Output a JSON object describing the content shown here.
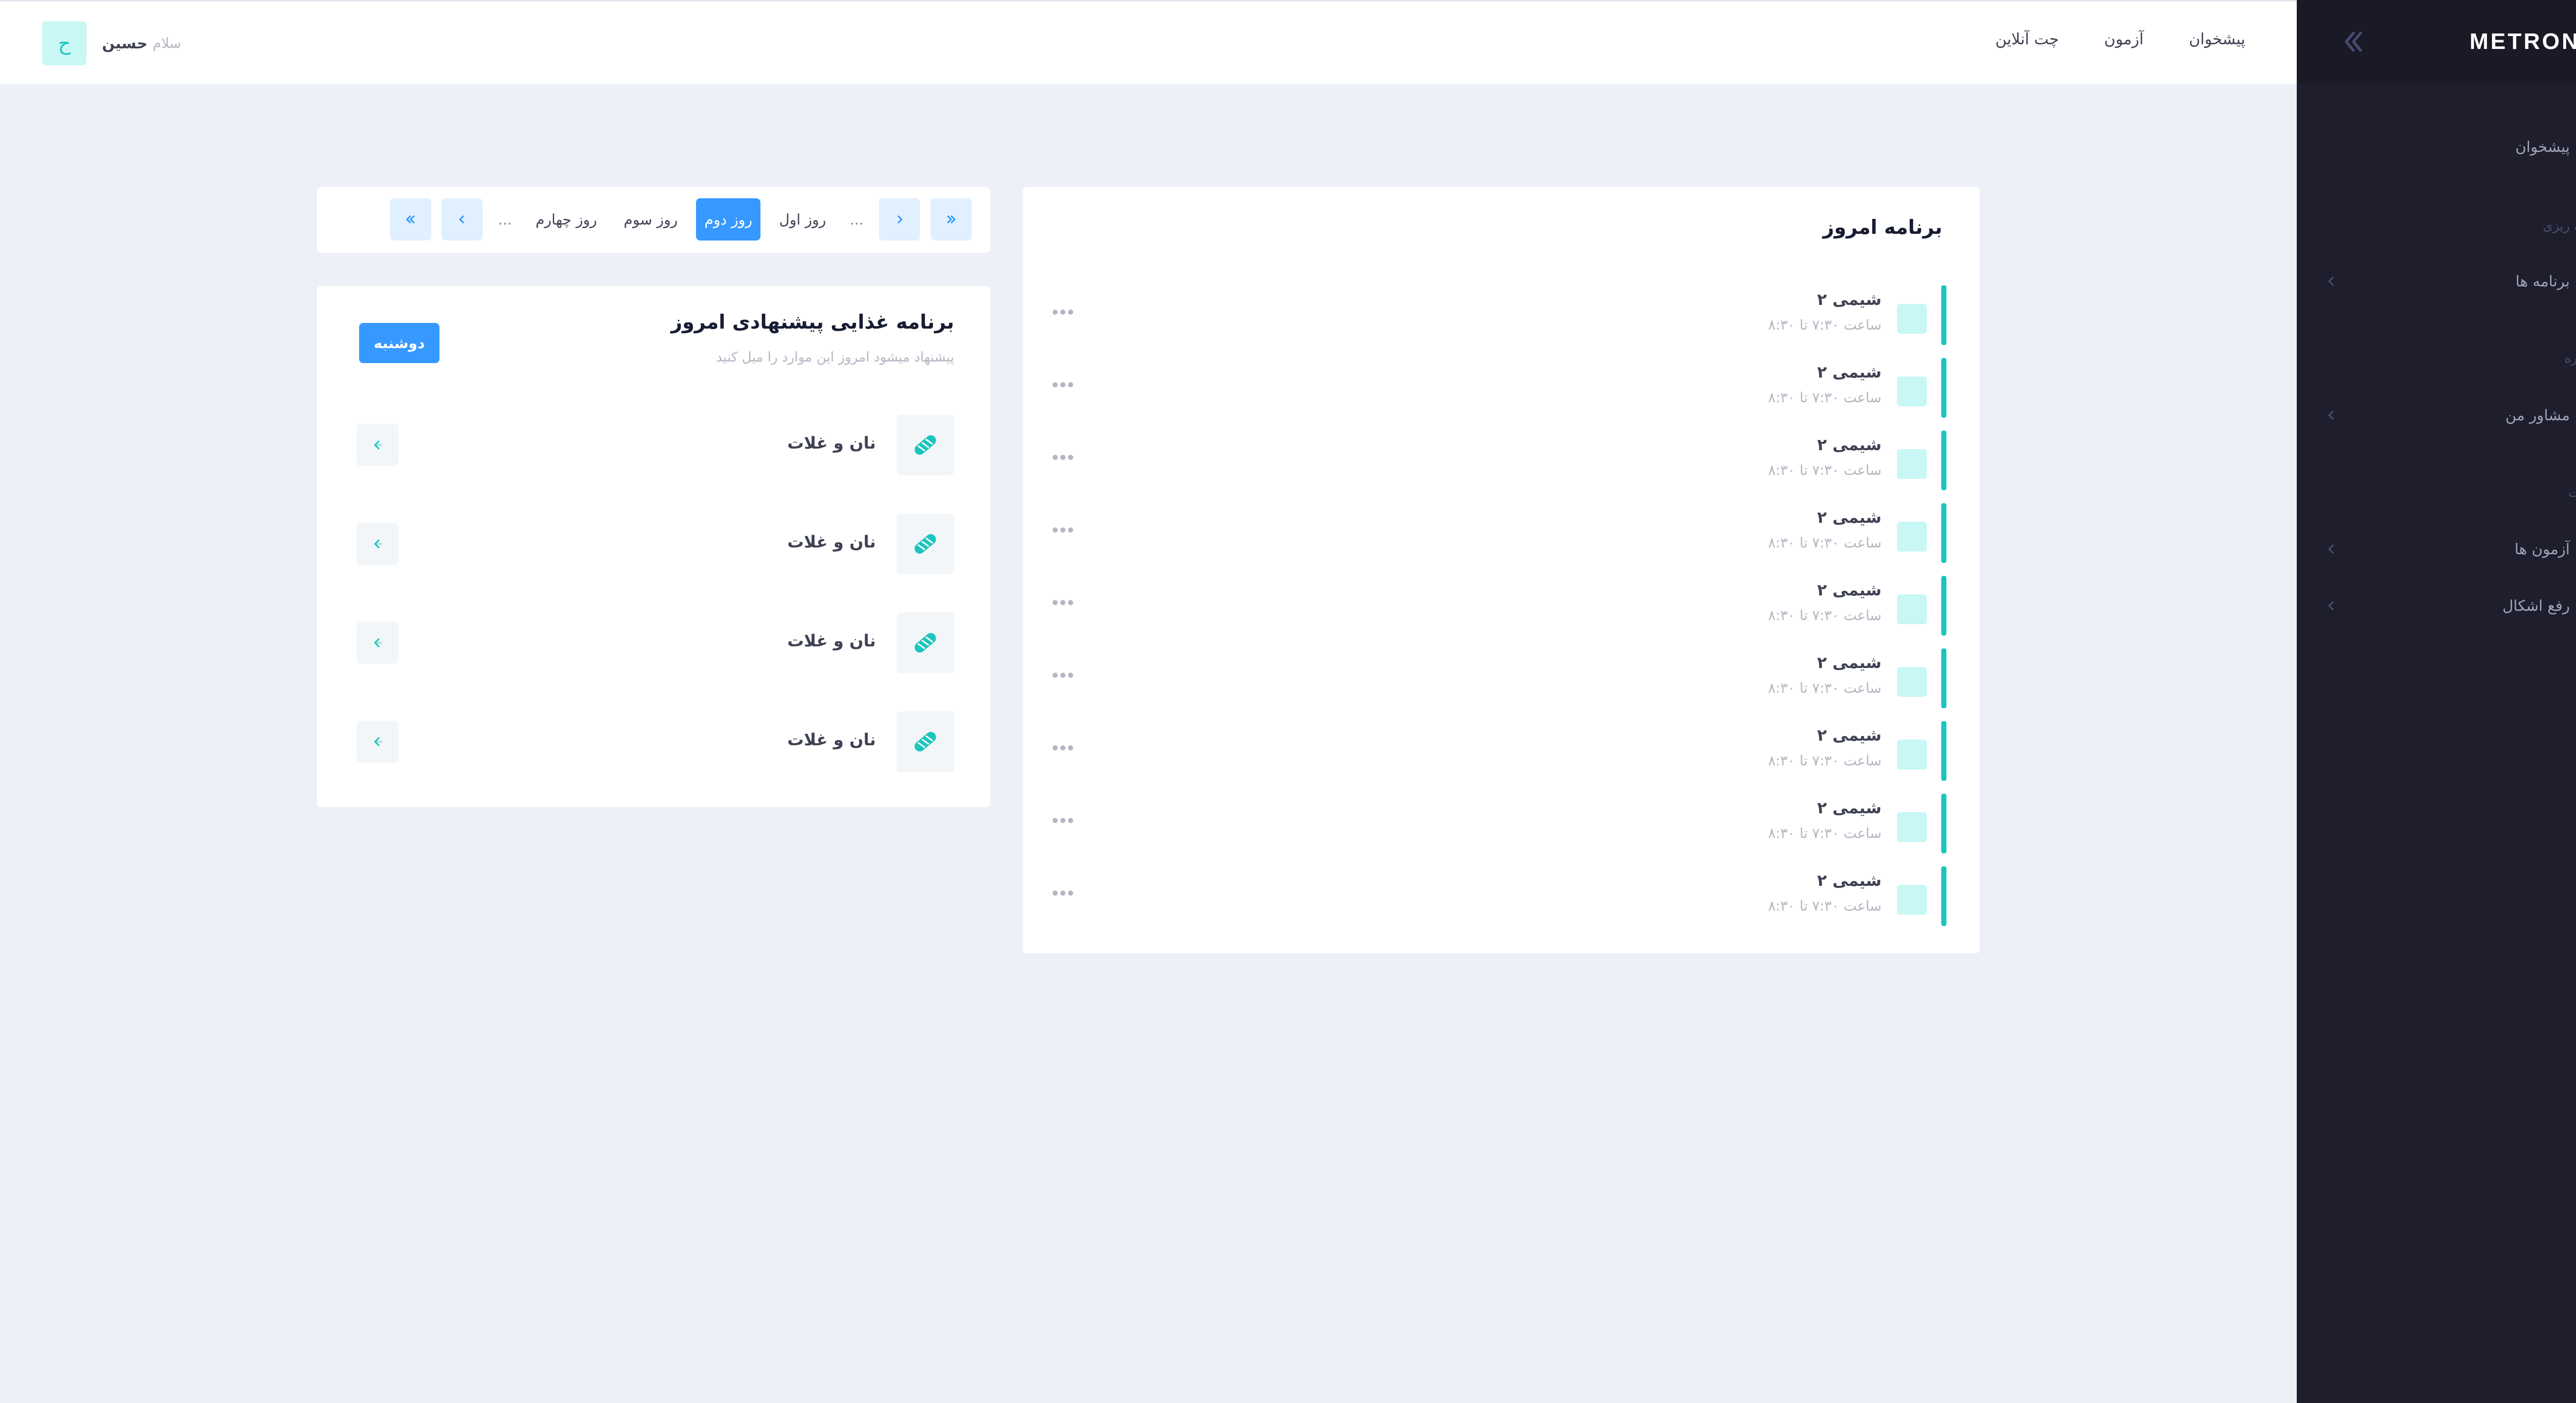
{
  "sidebar": {
    "brand": "METRONIC",
    "items": [
      {
        "label": "پیشخوان",
        "icon": "diamond-icon"
      },
      {
        "label": "برنامه ها",
        "icon": "grid-icon"
      },
      {
        "label": "مشاور من",
        "icon": "bucket-icon"
      },
      {
        "label": "آزمون ها",
        "icon": "test-tubes-icon"
      },
      {
        "label": "رفع اشکال",
        "icon": "list-icon"
      }
    ],
    "sections": [
      "برنامه ریزی",
      "مشاوره",
      "خدمات"
    ]
  },
  "header": {
    "nav": [
      "پیشخوان",
      "آزمون",
      "چت آنلاین"
    ],
    "greeting": "سلام",
    "user_name": "حسین",
    "avatar_letter": "ح"
  },
  "schedule": {
    "title": "برنامه امروز",
    "items": [
      {
        "title": "شیمی ۲",
        "time": "ساعت ۷:۳۰ تا ۸:۳۰"
      },
      {
        "title": "شیمی ۲",
        "time": "ساعت ۷:۳۰ تا ۸:۳۰"
      },
      {
        "title": "شیمی ۲",
        "time": "ساعت ۷:۳۰ تا ۸:۳۰"
      },
      {
        "title": "شیمی ۲",
        "time": "ساعت ۷:۳۰ تا ۸:۳۰"
      },
      {
        "title": "شیمی ۲",
        "time": "ساعت ۷:۳۰ تا ۸:۳۰"
      },
      {
        "title": "شیمی ۲",
        "time": "ساعت ۷:۳۰ تا ۸:۳۰"
      },
      {
        "title": "شیمی ۲",
        "time": "ساعت ۷:۳۰ تا ۸:۳۰"
      },
      {
        "title": "شیمی ۲",
        "time": "ساعت ۷:۳۰ تا ۸:۳۰"
      },
      {
        "title": "شیمی ۲",
        "time": "ساعت ۷:۳۰ تا ۸:۳۰"
      }
    ]
  },
  "pager": {
    "ellipsis": "...",
    "days": [
      "روز اول",
      "روز دوم",
      "روز سوم",
      "روز چهارم"
    ],
    "active_day": "روز دوم"
  },
  "meal": {
    "title": "برنامه غذایی پیشنهادی امروز",
    "subtitle": "پیشنهاد میشود امروز این موارد را میل کنید",
    "day_button": "دوشنبه",
    "items": [
      {
        "label": "نان و غلات",
        "icon": "bread-icon"
      },
      {
        "label": "نان و غلات",
        "icon": "bread-icon"
      },
      {
        "label": "نان و غلات",
        "icon": "bread-icon"
      },
      {
        "label": "نان و غلات",
        "icon": "bread-icon"
      }
    ]
  },
  "colors": {
    "accent": "#3699ff",
    "success": "#1bc5bd",
    "sidebar_bg": "#1e1e2d",
    "page_bg": "#eef0f8"
  }
}
